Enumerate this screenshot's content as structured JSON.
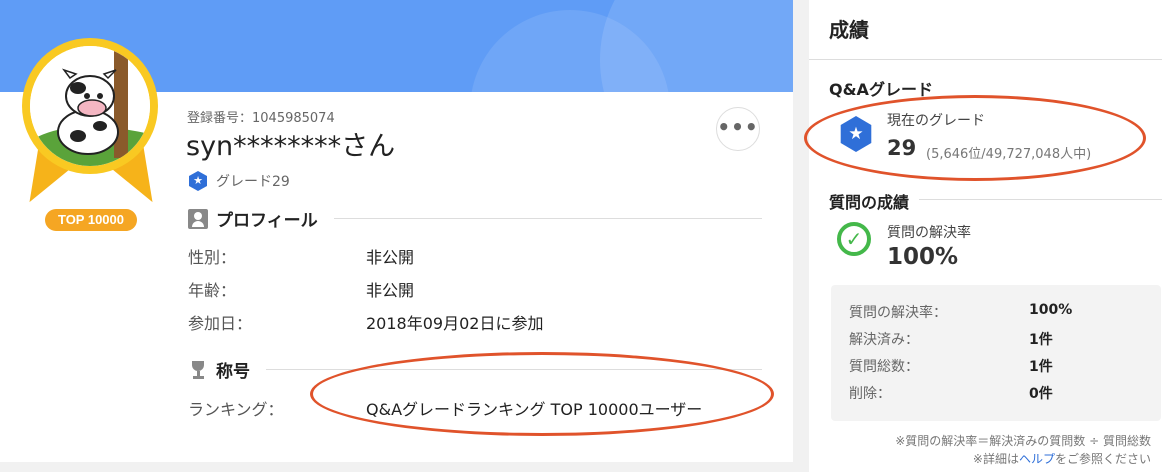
{
  "profile": {
    "badge": "TOP 10000",
    "registration": "登録番号：1045985074",
    "username": "syn********さん",
    "grade": "グレード29",
    "menu": "•••",
    "profile_heading": "プロフィール",
    "fields": [
      {
        "label": "性別：",
        "value": "非公開"
      },
      {
        "label": "年齢：",
        "value": "非公開"
      },
      {
        "label": "参加日：",
        "value": "2018年09月02日に参加"
      }
    ],
    "title_heading": "称号",
    "ranking_label": "ランキング：",
    "ranking_value": "Q&Aグレードランキング TOP 10000ユーザー"
  },
  "results": {
    "title": "成績",
    "qa_grade_heading": "Q&Aグレード",
    "current_grade_label": "現在のグレード",
    "current_grade": "29",
    "grade_rank": "(5,646位/49,727,048人中)",
    "question_heading": "質問の成績",
    "resolution_label": "質問の解決率",
    "resolution_value": "100%",
    "stats": [
      {
        "label": "質問の解決率：",
        "value": "100%"
      },
      {
        "label": "解決済み：",
        "value": "1件"
      },
      {
        "label": "質問総数：",
        "value": "1件"
      },
      {
        "label": "削除：",
        "value": "0件"
      }
    ],
    "note1": "※質問の解決率＝解決済みの質問数 ÷ 質問総数",
    "note2_prefix": "※詳細は",
    "note2_link": "ヘルプ",
    "note2_suffix": "をご参照ください"
  },
  "colors": {
    "accent": "#2f6fd8",
    "banner": "#5f9cf6",
    "badge": "#f5a623",
    "highlight": "#e0532b",
    "check": "#44b84a"
  }
}
